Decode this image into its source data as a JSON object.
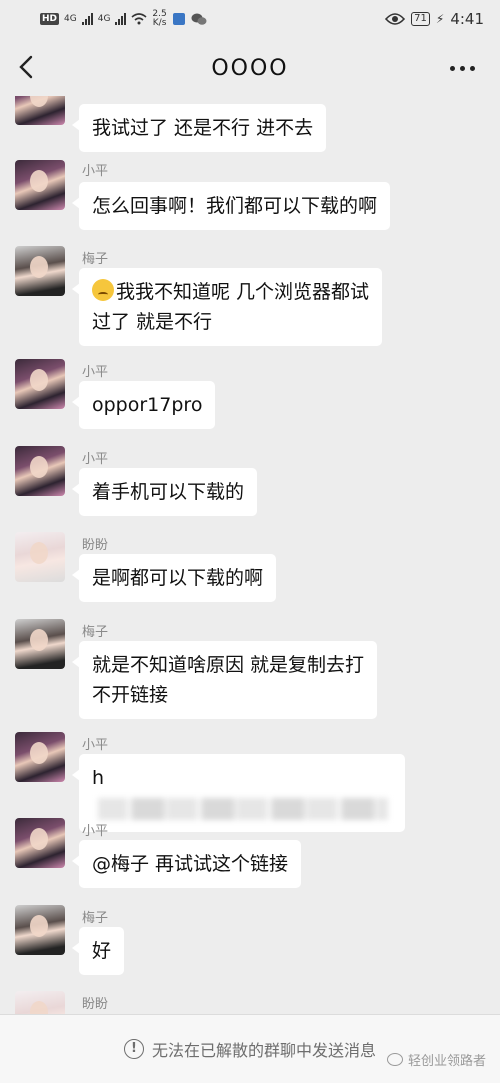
{
  "status_bar": {
    "hd_label": "HD",
    "sim_label": "1",
    "net1": "4G",
    "net2": "4G",
    "speed": "2.5",
    "speed_unit": "K/s",
    "battery": "71",
    "time": "4:41"
  },
  "header": {
    "title": "OOOO"
  },
  "messages": [
    {
      "sender": "",
      "text": "我试过了  还是不行  进不去"
    },
    {
      "sender": "小平",
      "text": "怎么回事啊！我们都可以下载的啊"
    },
    {
      "sender": "梅子",
      "line1": "我我不知道呢  几个浏览器都试",
      "line2": "过了  就是不行"
    },
    {
      "sender": "小平",
      "text": "oppor17pro"
    },
    {
      "sender": "小平",
      "text": "着手机可以下载的"
    },
    {
      "sender": "盼盼",
      "text": "是啊都可以下载的啊"
    },
    {
      "sender": "梅子",
      "line1": "就是不知道啥原因  就是复制去打",
      "line2": "不开链接"
    },
    {
      "sender": "小平",
      "text": "h"
    },
    {
      "sender": "小平",
      "text": "@梅子  再试试这个链接"
    },
    {
      "sender": "梅子",
      "text": "好"
    },
    {
      "sender": "盼盼",
      "text": ""
    }
  ],
  "footer": {
    "notice": "无法在已解散的群聊中发送消息",
    "watermark": "轻创业领路者"
  }
}
